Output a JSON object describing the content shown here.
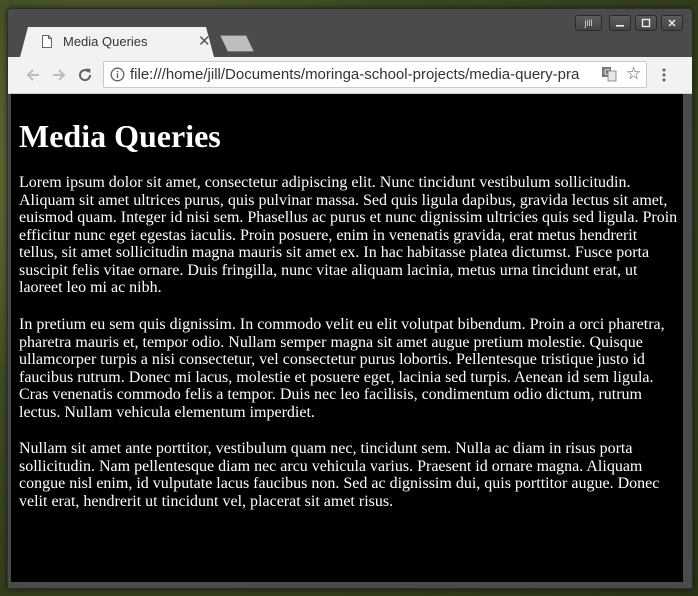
{
  "tab": {
    "title": "Media Queries"
  },
  "window_controls": {
    "user_label": "jill"
  },
  "toolbar": {
    "url": "file:///home/jill/Documents/moringa-school-projects/media-query-pra"
  },
  "page": {
    "heading": "Media Queries",
    "paragraphs": [
      "Lorem ipsum dolor sit amet, consectetur adipiscing elit. Nunc tincidunt vestibulum sollicitudin. Aliquam sit amet ultrices purus, quis pulvinar massa. Sed quis ligula dapibus, gravida lectus sit amet, euismod quam. Integer id nisi sem. Phasellus ac purus et nunc dignissim ultricies quis sed ligula. Proin efficitur nunc eget egestas iaculis. Proin posuere, enim in venenatis gravida, erat metus hendrerit tellus, sit amet sollicitudin magna mauris sit amet ex. In hac habitasse platea dictumst. Fusce porta suscipit felis vitae ornare. Duis fringilla, nunc vitae aliquam lacinia, metus urna tincidunt erat, ut laoreet leo mi ac nibh.",
      "In pretium eu sem quis dignissim. In commodo velit eu elit volutpat bibendum. Proin a orci pharetra, pharetra mauris et, tempor odio. Nullam semper magna sit amet augue pretium molestie. Quisque ullamcorper turpis a nisi consectetur, vel consectetur purus lobortis. Pellentesque tristique justo id faucibus rutrum. Donec mi lacus, molestie et posuere eget, lacinia sed turpis. Aenean id sem ligula. Cras venenatis commodo felis a tempor. Duis nec leo facilisis, condimentum odio dictum, rutrum lectus. Nullam vehicula elementum imperdiet.",
      "Nullam sit amet ante porttitor, vestibulum quam nec, tincidunt sem. Nulla ac diam in risus porta sollicitudin. Nam pellentesque diam nec arcu vehicula varius. Praesent id ornare magna. Aliquam congue nisl enim, id vulputate lacus faucibus non. Sed ac dignissim dui, quis porttitor augue. Donec velit erat, hendrerit ut tincidunt vel, placerat sit amet risus."
    ]
  },
  "colors": {
    "page_background": "#000000",
    "page_text": "#ffffff",
    "chrome_frame": "#4b4b4b",
    "toolbar": "#f2f2f2"
  },
  "icons": [
    "page-icon",
    "tab-close-icon",
    "back-arrow-icon",
    "forward-arrow-icon",
    "reload-icon",
    "info-icon",
    "translate-icon",
    "star-icon",
    "menu-dots-icon",
    "minimize-icon",
    "maximize-icon",
    "close-icon"
  ]
}
